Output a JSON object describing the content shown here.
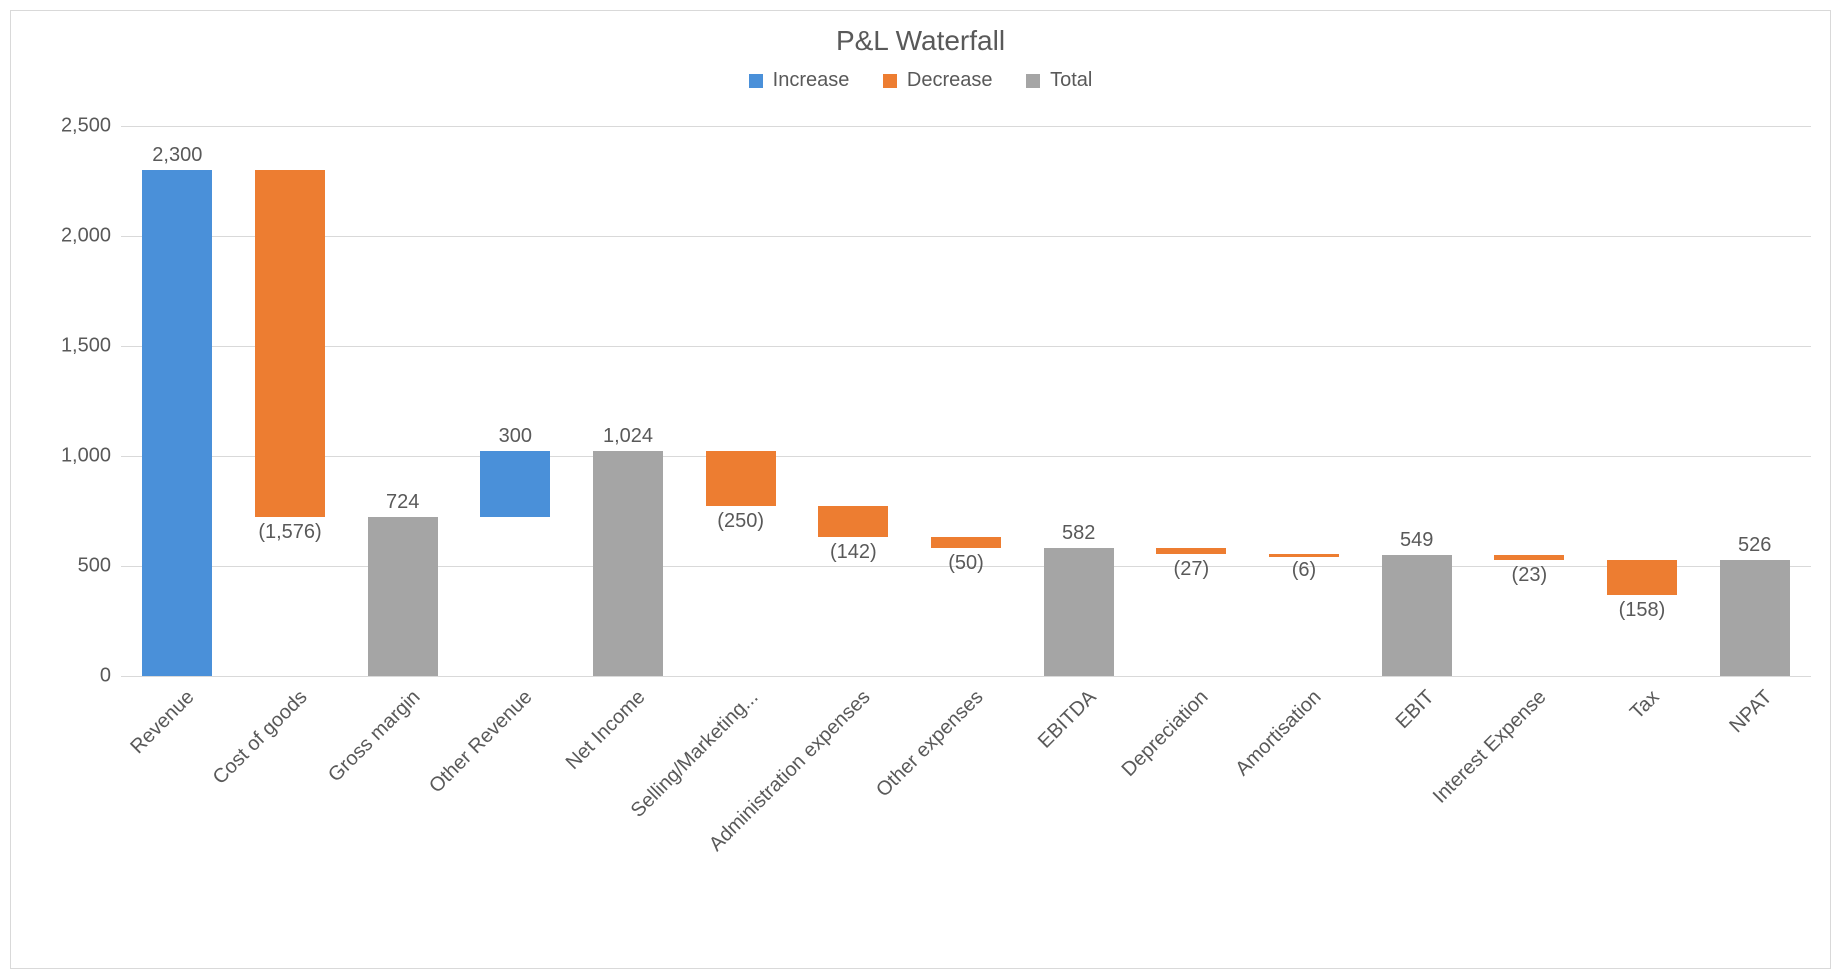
{
  "chart_data": {
    "type": "waterfall",
    "title": "P&L Waterfall",
    "legend": [
      {
        "name": "Increase",
        "color": "#4a90d9"
      },
      {
        "name": "Decrease",
        "color": "#ed7d31"
      },
      {
        "name": "Total",
        "color": "#a5a5a5"
      }
    ],
    "ylim": [
      0,
      2500
    ],
    "yticks": [
      0,
      500,
      1000,
      1500,
      2000,
      2500
    ],
    "ytick_labels": [
      "0",
      "500",
      "1,000",
      "1,500",
      "2,000",
      "2,500"
    ],
    "items": [
      {
        "category": "Revenue",
        "value": 2300,
        "display": "2,300",
        "kind": "increase",
        "cum_before": 0,
        "cum_after": 2300
      },
      {
        "category": "Cost of goods",
        "value": -1576,
        "display": "(1,576)",
        "kind": "decrease",
        "cum_before": 2300,
        "cum_after": 724
      },
      {
        "category": "Gross margin",
        "value": 724,
        "display": "724",
        "kind": "total",
        "cum_before": 0,
        "cum_after": 724
      },
      {
        "category": "Other Revenue",
        "value": 300,
        "display": "300",
        "kind": "increase",
        "cum_before": 724,
        "cum_after": 1024
      },
      {
        "category": "Net Income",
        "value": 1024,
        "display": "1,024",
        "kind": "total",
        "cum_before": 0,
        "cum_after": 1024
      },
      {
        "category": "Selling/Marketing...",
        "value": -250,
        "display": "(250)",
        "kind": "decrease",
        "cum_before": 1024,
        "cum_after": 774
      },
      {
        "category": "Administration expenses",
        "value": -142,
        "display": "(142)",
        "kind": "decrease",
        "cum_before": 774,
        "cum_after": 632
      },
      {
        "category": "Other expenses",
        "value": -50,
        "display": "(50)",
        "kind": "decrease",
        "cum_before": 632,
        "cum_after": 582
      },
      {
        "category": "EBITDA",
        "value": 582,
        "display": "582",
        "kind": "total",
        "cum_before": 0,
        "cum_after": 582
      },
      {
        "category": "Depreciation",
        "value": -27,
        "display": "(27)",
        "kind": "decrease",
        "cum_before": 582,
        "cum_after": 555
      },
      {
        "category": "Amortisation",
        "value": -6,
        "display": "(6)",
        "kind": "decrease",
        "cum_before": 555,
        "cum_after": 549
      },
      {
        "category": "EBIT",
        "value": 549,
        "display": "549",
        "kind": "total",
        "cum_before": 0,
        "cum_after": 549
      },
      {
        "category": "Interest Expense",
        "value": -23,
        "display": "(23)",
        "kind": "decrease",
        "cum_before": 549,
        "cum_after": 526
      },
      {
        "category": "Tax",
        "value": -158,
        "display": "(158)",
        "kind": "decrease",
        "cum_before": 526,
        "cum_after": 368
      },
      {
        "category": "NPAT",
        "value": 526,
        "display": "526",
        "kind": "total",
        "cum_before": 0,
        "cum_after": 526
      }
    ]
  }
}
